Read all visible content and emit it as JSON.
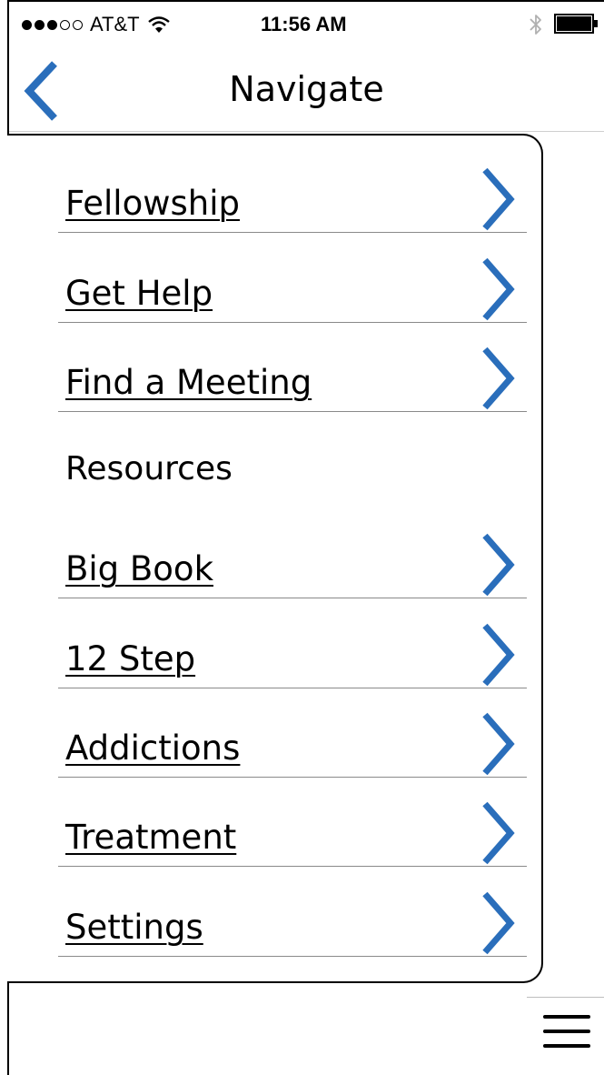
{
  "status_bar": {
    "carrier": "AT&T",
    "signal_filled": 3,
    "signal_empty": 2,
    "time": "11:56 AM",
    "icons": [
      "wifi-icon",
      "bluetooth-icon",
      "battery-icon"
    ]
  },
  "nav": {
    "title": "Navigate",
    "back_icon": "chevron-left-icon"
  },
  "menu": {
    "items": [
      {
        "label": "Fellowship",
        "type": "link"
      },
      {
        "label": "Get Help",
        "type": "link"
      },
      {
        "label": "Find a Meeting",
        "type": "link"
      },
      {
        "label": "Resources",
        "type": "section"
      },
      {
        "label": "Big Book",
        "type": "link"
      },
      {
        "label": "12 Step",
        "type": "link"
      },
      {
        "label": "Addictions",
        "type": "link"
      },
      {
        "label": "Treatment",
        "type": "link"
      },
      {
        "label": "Settings",
        "type": "link"
      }
    ],
    "chevron_icon": "chevron-right-icon"
  },
  "bottom": {
    "menu_icon": "hamburger-icon"
  },
  "colors": {
    "accent": "#2a6ebb",
    "divider": "#8a8a8a",
    "text": "#000000"
  }
}
